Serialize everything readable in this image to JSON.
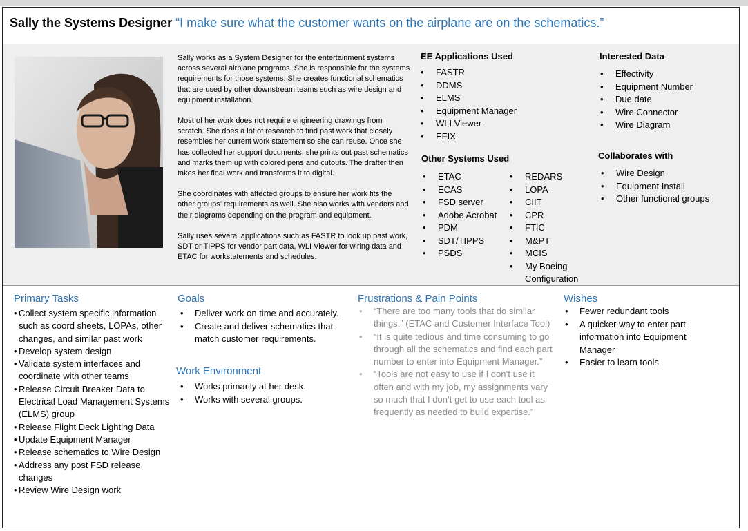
{
  "persona": {
    "name": "Sally the Systems Designer",
    "quote": "“I make sure what the customer wants on the airplane are on the schematics.”"
  },
  "bio": {
    "paragraphs": [
      "Sally works as a System Designer for the entertainment systems across several airplane programs.  She is responsible for the systems requirements for those systems.  She creates functional schematics that are used by other downstream teams such as wire design and equipment installation.",
      "Most of her work does not require engineering drawings from scratch.  She does a lot of research to find past work that closely resembles her current work statement so she can reuse.  Once she has collected her support documents, she prints out past schematics and marks them up with colored pens and cutouts.  The drafter then takes her final work and transforms it to digital.",
      "She coordinates with affected groups to ensure her work fits the other groups’ requirements as well. She also works with vendors and their diagrams depending on the program and equipment.",
      "Sally uses several applications such as FASTR to look up past work, SDT or TIPPS for vendor part data, WLI Viewer for wiring data and ETAC for workstatements and schedules."
    ]
  },
  "ee_apps": {
    "heading": "EE Applications Used",
    "items": [
      "FASTR",
      "DDMS",
      "ELMS",
      "Equipment Manager",
      "WLI Viewer",
      "EFIX"
    ]
  },
  "other_systems": {
    "heading": "Other Systems Used",
    "col1": [
      "ETAC",
      "ECAS",
      "FSD server",
      "Adobe Acrobat",
      "PDM",
      "SDT/TIPPS",
      "PSDS"
    ],
    "col2": [
      "REDARS",
      "LOPA",
      "CIIT",
      "CPR",
      "FTIC",
      "M&PT",
      "MCIS",
      "My Boeing",
      "Configuration"
    ]
  },
  "interested_data": {
    "heading": "Interested Data",
    "items": [
      "Effectivity",
      "Equipment Number",
      "Due date",
      "Wire Connector",
      "Wire Diagram"
    ]
  },
  "collaborates": {
    "heading": "Collaborates with",
    "items": [
      "Wire Design",
      "Equipment Install",
      "Other functional groups"
    ]
  },
  "primary_tasks": {
    "heading": "Primary Tasks",
    "items": [
      "Collect system specific information such as coord sheets, LOPAs, other changes, and similar past work",
      "Develop system design",
      "Validate system interfaces  and coordinate with other teams",
      "Release Circuit Breaker Data to Electrical Load Management Systems (ELMS) group",
      "Release Flight Deck Lighting Data",
      "Update Equipment Manager",
      "Release schematics to Wire Design",
      "Address any post FSD release changes",
      "Review Wire Design work"
    ]
  },
  "goals": {
    "heading": "Goals",
    "items": [
      "Deliver work on time and accurately.",
      "Create and deliver schematics that match customer requirements."
    ]
  },
  "work_env": {
    "heading": "Work Environment",
    "items": [
      "Works primarily at her desk.",
      "Works with several groups."
    ]
  },
  "frustrations": {
    "heading": "Frustrations & Pain Points",
    "items": [
      "“There are too many tools that do similar things.” (ETAC and Customer Interface Tool)",
      "“It is quite tedious and time consuming to go through all the schematics and find each part number to enter into Equipment Manager.”",
      "“Tools are not easy to use if I don’t use it often and with my job, my assignments vary so much that I don’t get to use each tool as frequently as needed to build expertise.”"
    ]
  },
  "wishes": {
    "heading": "Wishes",
    "items": [
      "Fewer redundant tools",
      "A quicker way to enter part information into Equipment Manager",
      "Easier to learn tools"
    ]
  },
  "colors": {
    "accent": "#2e75b6",
    "panel": "#efefef",
    "muted": "#8a8a8a"
  }
}
